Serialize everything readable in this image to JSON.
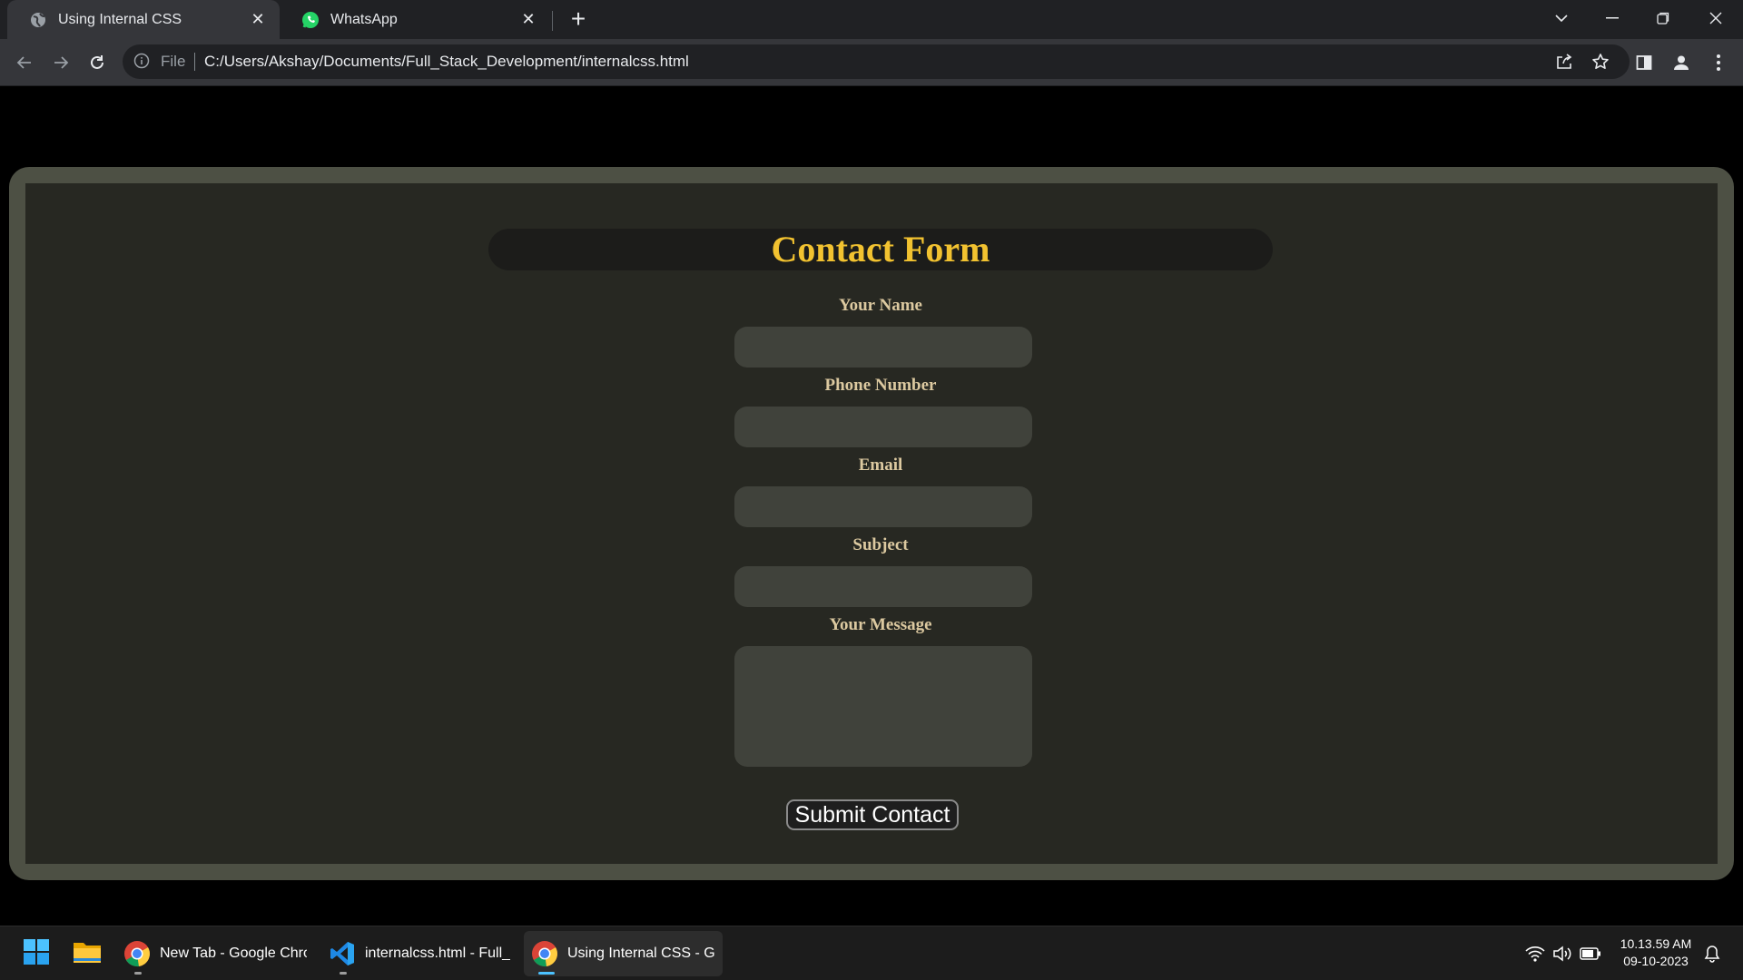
{
  "browser": {
    "tabs": [
      {
        "title": "Using Internal CSS",
        "active": true
      },
      {
        "title": "WhatsApp",
        "active": false
      }
    ],
    "new_tab_glyph": "+",
    "address": {
      "scheme_label": "File",
      "url": "C:/Users/Akshay/Documents/Full_Stack_Development/internalcss.html"
    }
  },
  "form": {
    "heading": "Contact Form",
    "fields": [
      {
        "label": "Your Name"
      },
      {
        "label": "Phone Number"
      },
      {
        "label": "Email"
      },
      {
        "label": "Subject"
      },
      {
        "label": "Your Message"
      }
    ],
    "submit_label": "Submit Contact"
  },
  "taskbar": {
    "items": [
      {
        "label": "New Tab - Google Chrome",
        "icon": "chrome-icon"
      },
      {
        "label": "internalcss.html - Full_Stack_Development",
        "icon": "vscode-icon"
      },
      {
        "label": "Using Internal CSS - Google Chrome",
        "icon": "chrome-icon",
        "active": true
      }
    ],
    "time": "10.13.59 AM",
    "date": "09-10-2023"
  },
  "colors": {
    "heading": "#f2c230",
    "label": "#dcc9a0",
    "frame": "#4d5044",
    "panel": "#272822",
    "input": "#40423b"
  }
}
